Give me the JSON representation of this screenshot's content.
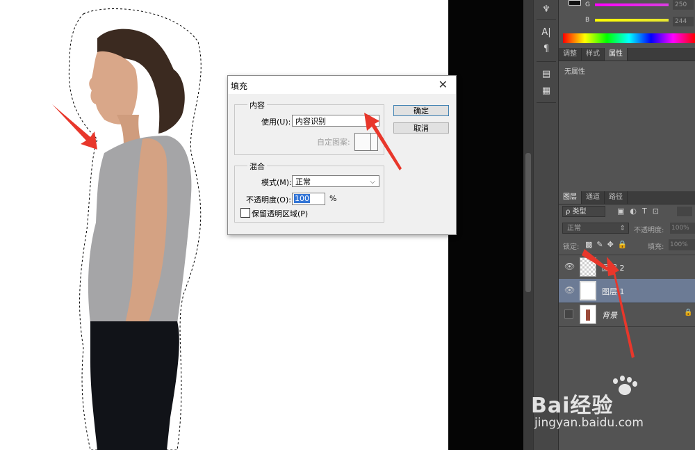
{
  "fill_dialog": {
    "title": "填充",
    "close_glyph": "✕",
    "content_group": "内容",
    "use_label": "使用(U):",
    "use_value": "内容识别",
    "custom_pattern_label": "自定图案:",
    "blend_group": "混合",
    "mode_label": "模式(M):",
    "mode_value": "正常",
    "opacity_label": "不透明度(O):",
    "opacity_value": "100",
    "opacity_unit": "%",
    "preserve_label": "保留透明区域(P)",
    "ok_label": "确定",
    "cancel_label": "取消"
  },
  "color_panel": {
    "g_label": "G",
    "g_value": "250",
    "b_label": "B",
    "b_value": "244",
    "g_color": "#d93ee0",
    "b_color": "#e6e633"
  },
  "properties_panel": {
    "tabs": [
      "调整",
      "样式",
      "属性"
    ],
    "active_tab": 2,
    "empty_text": "无属性"
  },
  "layers_panel": {
    "tabs": [
      "图层",
      "通道",
      "路径"
    ],
    "active_tab": 0,
    "filter_label": "ρ 类型",
    "blend_mode": "正常",
    "opacity_label": "不透明度:",
    "opacity_value": "100%",
    "lock_label": "锁定:",
    "fill_label": "填充:",
    "fill_value": "100%",
    "layers": [
      {
        "name": "图层 2",
        "selected": false,
        "visible": true
      },
      {
        "name": "图层 1",
        "selected": true,
        "visible": true
      },
      {
        "name": "背景",
        "selected": false,
        "visible": false
      }
    ]
  },
  "watermark": {
    "brand": "Bai经验",
    "url": "jingyan.baidu.com"
  },
  "colors": {
    "canvas_bg": "#ffffff",
    "panel_bg": "#535353",
    "selected_layer": "#6c7b95",
    "annotation_arrow": "#e8372b",
    "dialog_focus": "#3c7fb1"
  }
}
